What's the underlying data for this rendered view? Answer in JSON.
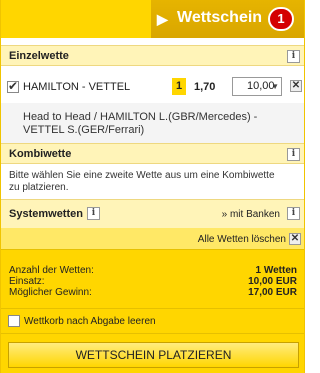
{
  "header": {
    "arrow": "▶",
    "title": "Wettschein",
    "count": "1"
  },
  "single": {
    "title": "Einzelwette",
    "selection": "HAMILTON - VETTEL",
    "number": "1",
    "odds": "1,70",
    "stake": "10,00",
    "detail": "Head to Head / HAMILTON L.(GBR/Mercedes) - VETTEL S.(GER/Ferrari)"
  },
  "kombi": {
    "title": "Kombiwette",
    "text": "Bitte wählen Sie eine zweite Wette aus um eine Kombiwette zu platzieren."
  },
  "system": {
    "title": "Systemwetten",
    "banken": "» mit Banken"
  },
  "clear_all": "Alle Wetten löschen",
  "summary": [
    {
      "label": "Anzahl der Wetten:",
      "value": "1 Wetten"
    },
    {
      "label": "Einsatz:",
      "value": "10,00 EUR"
    },
    {
      "label": "Möglicher Gewinn:",
      "value": "17,00 EUR"
    }
  ],
  "keep_label": "Wettkorb nach Abgabe leeren",
  "place_button": "WETTSCHEIN PLATZIEREN",
  "icons": {
    "info": "i",
    "close": "✕",
    "dropdown": "▼"
  },
  "colors": {
    "accent": "#ffd600",
    "badge": "#d40000",
    "header": "#dcaa00"
  }
}
